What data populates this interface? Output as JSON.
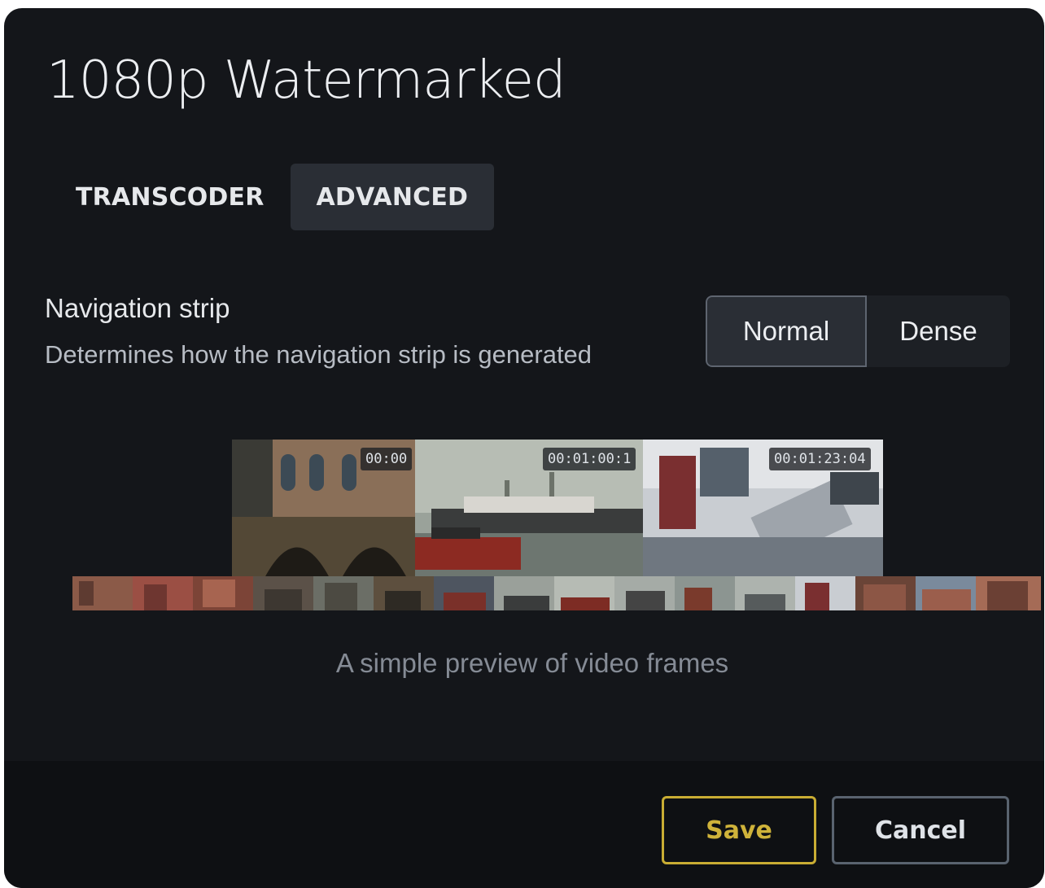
{
  "dialog": {
    "title": "1080p Watermarked"
  },
  "tabs": [
    {
      "label": "TRANSCODER",
      "active": false
    },
    {
      "label": "ADVANCED",
      "active": true
    }
  ],
  "setting": {
    "title": "Navigation strip",
    "description": "Determines how the navigation strip is generated",
    "options": [
      {
        "label": "Normal",
        "selected": true
      },
      {
        "label": "Dense",
        "selected": false
      }
    ]
  },
  "preview": {
    "frames": [
      {
        "timestamp": "00:00"
      },
      {
        "timestamp": "00:01:00:1"
      },
      {
        "timestamp": "00:01:23:04"
      }
    ],
    "caption": "A simple preview of video frames"
  },
  "footer": {
    "save_label": "Save",
    "cancel_label": "Cancel"
  },
  "colors": {
    "background": "#14161a",
    "footer_background": "#0e1013",
    "save_accent": "#c9ad33",
    "cancel_border": "#59636f",
    "tab_active": "#2a2e35"
  }
}
